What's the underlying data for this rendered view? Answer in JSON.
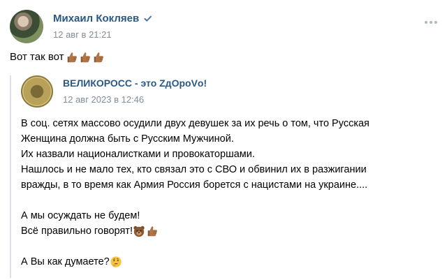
{
  "post": {
    "author": "Михаил Кокляев",
    "date": "12 авг в 21:21",
    "text": "Вот так вот",
    "text_emojis": [
      "thumbs-up",
      "thumbs-up",
      "thumbs-up"
    ]
  },
  "repost": {
    "author": "ВЕЛИКОРОСС - это ZдОроVо!",
    "date": "12 авг 2023 в 12:46",
    "lines": [
      "В соц. сетях массово осудили двух девушек за их речь о том, что Русская",
      "Женщина должна быть с Русским Мужчиной.",
      "Их назвали националистками и провокаторшами.",
      "Нашлось и не мало тех, кто связал это с СВО и обвинил их в разжигании",
      "вражды, в то время как Армия Россия борется с нацистами на украине....",
      "",
      "А мы осуждать не будем!",
      "Всё правильно говорят!",
      "",
      "А Вы как думаете?"
    ],
    "line_emojis": {
      "7": [
        "bear-face",
        "thumbs-up"
      ],
      "9": [
        "thinking-face"
      ]
    }
  },
  "colors": {
    "link": "#2a5885",
    "meta": "#818c99",
    "divider": "#dce1e6",
    "verified": "#4a76a8"
  },
  "icons": {
    "verified": "verified-check-icon",
    "more": "more-dots-icon"
  }
}
